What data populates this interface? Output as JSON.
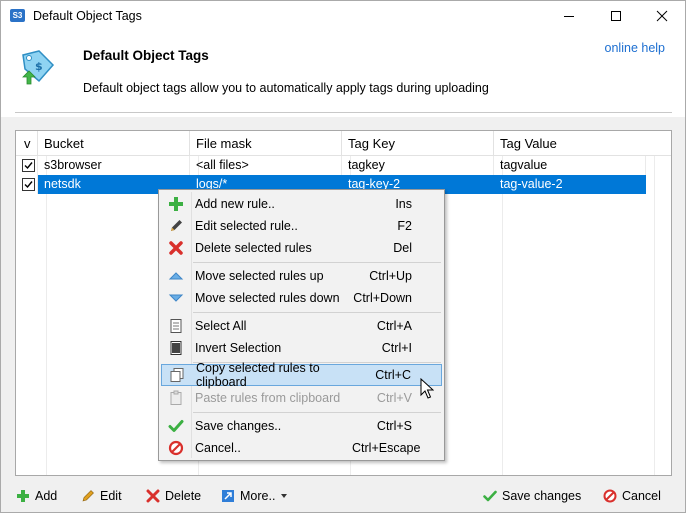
{
  "window": {
    "title": "Default Object Tags",
    "app_icon_text": "S3"
  },
  "header": {
    "title": "Default Object Tags",
    "description": "Default object tags allow you to automatically apply tags during uploading",
    "help_link": "online help"
  },
  "grid": {
    "columns": [
      "v",
      "Bucket",
      "File mask",
      "Tag Key",
      "Tag Value"
    ],
    "rows": [
      {
        "checked": true,
        "bucket": "s3browser",
        "file_mask": "<all files>",
        "tag_key": "tagkey",
        "tag_value": "tagvalue",
        "selected": false
      },
      {
        "checked": true,
        "bucket": "netsdk",
        "file_mask": "logs/*",
        "tag_key": "tag-key-2",
        "tag_value": "tag-value-2",
        "selected": true
      }
    ]
  },
  "context_menu": {
    "items": [
      {
        "label": "Add new rule..",
        "shortcut": "Ins",
        "icon": "plus-icon"
      },
      {
        "label": "Edit selected rule..",
        "shortcut": "F2",
        "icon": "pencil-icon"
      },
      {
        "label": "Delete selected rules",
        "shortcut": "Del",
        "icon": "red-x-icon"
      },
      {
        "label": "Move selected rules up",
        "shortcut": "Ctrl+Up",
        "icon": "triangle-up-icon"
      },
      {
        "label": "Move selected rules down",
        "shortcut": "Ctrl+Down",
        "icon": "triangle-down-icon"
      },
      {
        "label": "Select All",
        "shortcut": "Ctrl+A",
        "icon": "document-icon"
      },
      {
        "label": "Invert Selection",
        "shortcut": "Ctrl+I",
        "icon": "document-icon"
      },
      {
        "label": "Copy selected rules to clipboard",
        "shortcut": "Ctrl+C",
        "icon": "copy-icon"
      },
      {
        "label": "Paste rules from clipboard",
        "shortcut": "Ctrl+V",
        "icon": "clipboard-icon"
      },
      {
        "label": "Save changes..",
        "shortcut": "Ctrl+S",
        "icon": "checkmark-icon"
      },
      {
        "label": "Cancel..",
        "shortcut": "Ctrl+Escape",
        "icon": "no-entry-icon"
      }
    ]
  },
  "toolbar": {
    "add": "Add",
    "edit": "Edit",
    "delete": "Delete",
    "more": "More..",
    "save": "Save changes",
    "cancel": "Cancel"
  },
  "colors": {
    "selection": "#0078d7",
    "menu_highlight": "#c8e1f6",
    "link": "#1d6fd1"
  }
}
